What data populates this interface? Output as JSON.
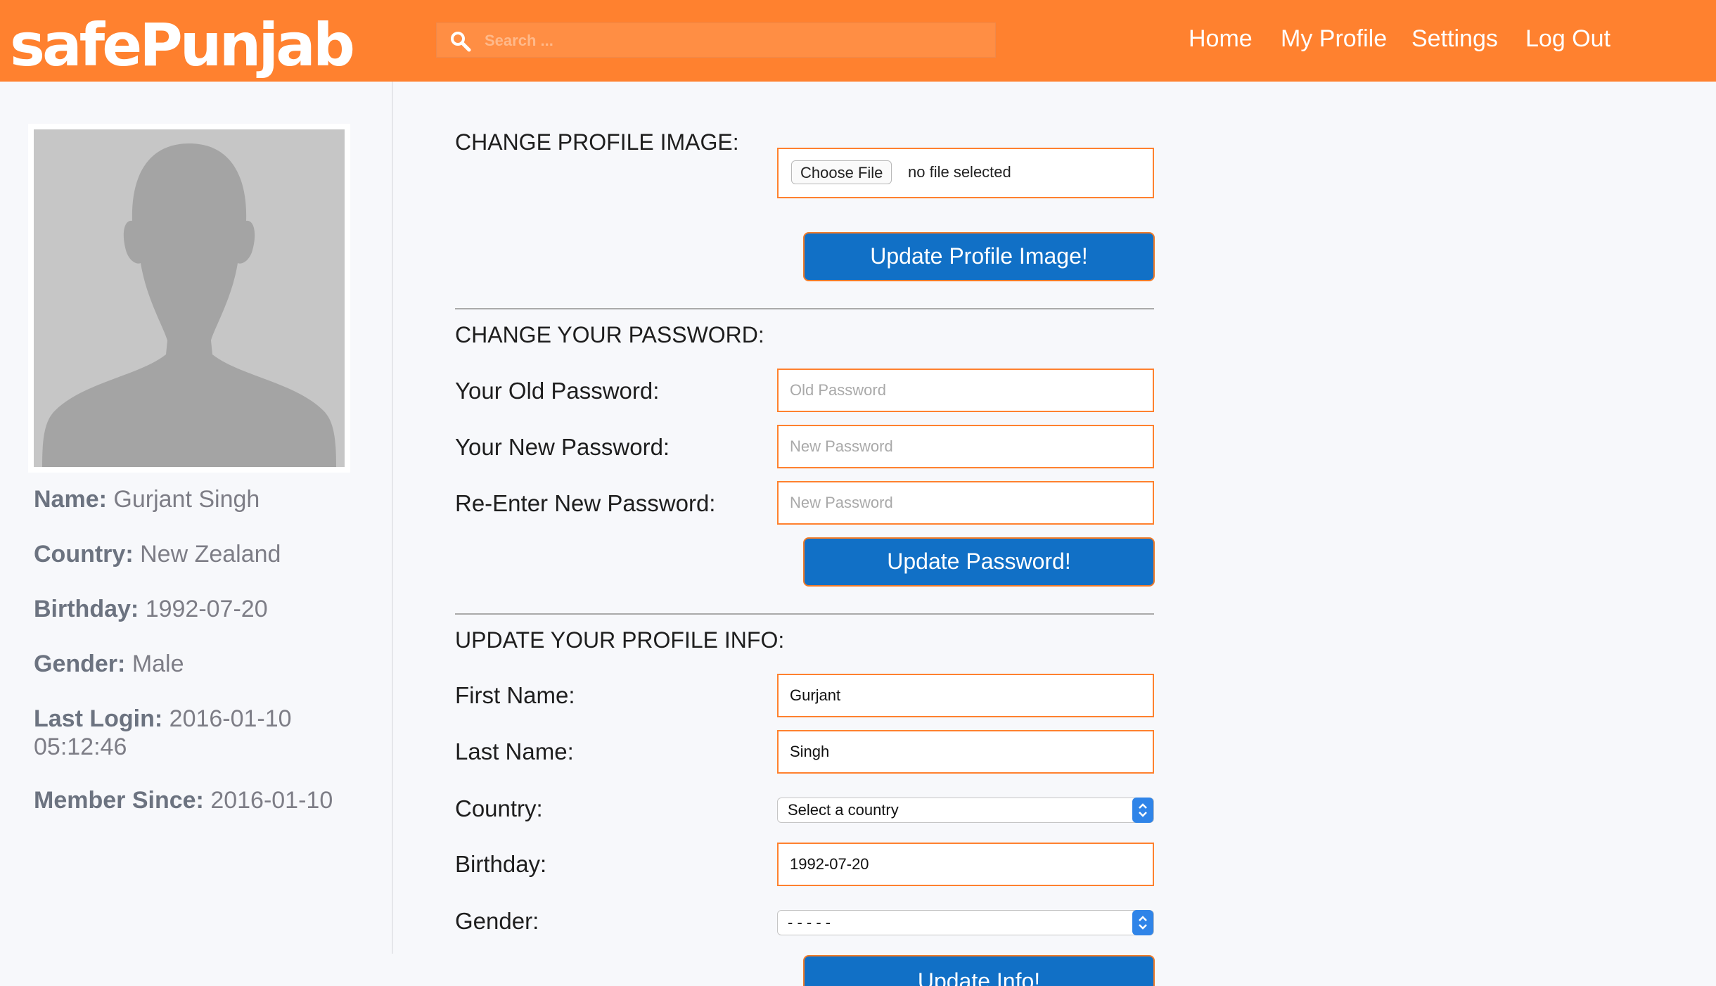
{
  "header": {
    "logo": "safePunjab",
    "search_placeholder": "Search ...",
    "nav": [
      "Home",
      "My Profile",
      "Settings",
      "Log Out"
    ]
  },
  "sidebar": {
    "profile": [
      {
        "label": "Name:",
        "value": "Gurjant Singh"
      },
      {
        "label": "Country:",
        "value": "New Zealand"
      },
      {
        "label": "Birthday:",
        "value": "1992-07-20"
      },
      {
        "label": "Gender:",
        "value": "Male"
      },
      {
        "label": "Last Login:",
        "value": "2016-01-10 05:12:46"
      },
      {
        "label": "Member Since:",
        "value": "2016-01-10"
      }
    ]
  },
  "image_section": {
    "title": "CHANGE PROFILE IMAGE:",
    "choose_file": "Choose File",
    "file_status": "no file selected",
    "button": "Update Profile Image!"
  },
  "password_section": {
    "title": "CHANGE YOUR PASSWORD:",
    "old_label": "Your Old Password:",
    "old_placeholder": "Old Password",
    "new_label": "Your New Password:",
    "new_placeholder": "New Password",
    "reenter_label": "Re-Enter New Password:",
    "reenter_placeholder": "New Password",
    "button": "Update Password!"
  },
  "info_section": {
    "title": "UPDATE YOUR PROFILE INFO:",
    "first_name_label": "First Name:",
    "first_name_value": "Gurjant",
    "last_name_label": "Last Name:",
    "last_name_value": "Singh",
    "country_label": "Country:",
    "country_value": "Select a country",
    "birthday_label": "Birthday:",
    "birthday_value": "1992-07-20",
    "gender_label": "Gender:",
    "gender_value": "- - - - -",
    "button": "Update Info!"
  },
  "colors": {
    "header": "#ff812f",
    "button": "#1170c6",
    "field_border": "#ff812f"
  }
}
